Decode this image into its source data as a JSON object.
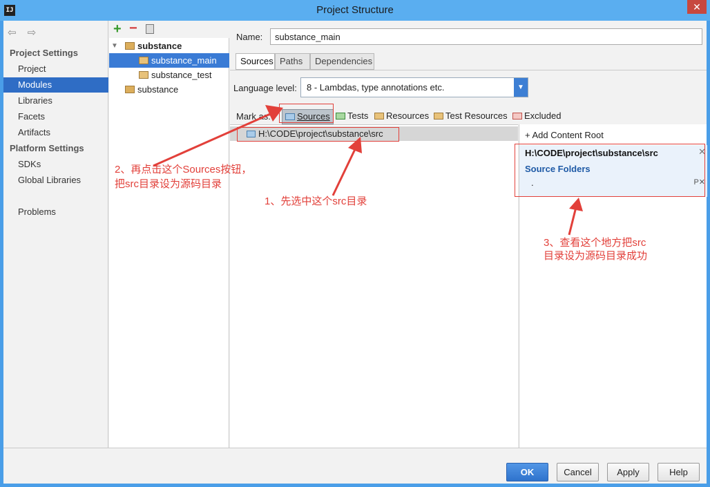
{
  "window": {
    "title": "Project Structure",
    "app_icon_text": "IJ",
    "close_glyph": "✕"
  },
  "nav": {
    "arrows": "⇦ ⇨",
    "project_settings_header": "Project Settings",
    "platform_settings_header": "Platform Settings",
    "items": [
      {
        "label": "Project"
      },
      {
        "label": "Modules"
      },
      {
        "label": "Libraries"
      },
      {
        "label": "Facets"
      },
      {
        "label": "Artifacts"
      },
      {
        "label": "SDKs"
      },
      {
        "label": "Global Libraries"
      },
      {
        "label": "Problems"
      }
    ]
  },
  "modules": {
    "toolbar": {
      "add": "+",
      "remove": "−"
    },
    "tree": [
      {
        "label": "substance"
      },
      {
        "label": "substance_main"
      },
      {
        "label": "substance_test"
      },
      {
        "label": "substance"
      }
    ]
  },
  "main": {
    "name_label": "Name:",
    "name_value": "substance_main",
    "tabs": [
      {
        "label": "Sources"
      },
      {
        "label": "Paths"
      },
      {
        "label": "Dependencies"
      }
    ],
    "language_level_label": "Language level:",
    "language_level_value": "8 - Lambdas, type annotations etc.",
    "mark_as_label": "Mark as:",
    "mark_buttons": [
      {
        "label": "Sources"
      },
      {
        "label": "Tests"
      },
      {
        "label": "Resources"
      },
      {
        "label": "Test Resources"
      },
      {
        "label": "Excluded"
      }
    ],
    "source_row": "H:\\CODE\\project\\substance\\src",
    "roots": {
      "add_label": "+ Add Content Root",
      "path": "H:\\CODE\\project\\substance\\src",
      "source_folders_label": "Source Folders",
      "folder_entry": ".",
      "entry_actions": "P✕"
    }
  },
  "footer": {
    "ok": "OK",
    "cancel": "Cancel",
    "apply": "Apply",
    "help": "Help"
  },
  "annotations": {
    "step1": "1、先选中这个src目录",
    "step2_line1": "2、再点击这个Sources按钮，",
    "step2_line2": "把src目录设为源码目录",
    "step3_line1": "3、查看这个地方把src",
    "step3_line2": "目录设为源码目录成功",
    "color": "#e2403a"
  },
  "colors": {
    "accent": "#2f6dc5",
    "titlebar": "#5aaef0",
    "selection": "#3a7bd5"
  }
}
